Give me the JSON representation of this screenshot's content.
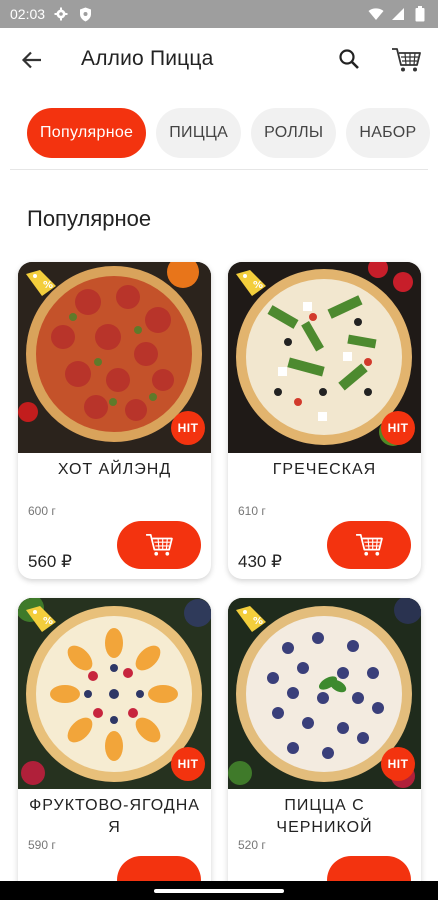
{
  "status_bar": {
    "time": "02:03",
    "icons": [
      "gear-icon",
      "shield-icon",
      "wifi-icon",
      "signal-icon",
      "battery-icon"
    ]
  },
  "app_bar": {
    "title": "Аллио Пицца",
    "back_icon": "arrow-left-icon",
    "search_icon": "search-icon",
    "cart_icon": "cart-icon"
  },
  "tabs": [
    {
      "label": "Популярное",
      "active": true
    },
    {
      "label": "ПИЦЦА",
      "active": false
    },
    {
      "label": "РОЛЛЫ",
      "active": false
    },
    {
      "label": "НАБОР",
      "active": false
    }
  ],
  "section": {
    "title": "Популярное"
  },
  "products": [
    {
      "name": "ХОТ АЙЛЭНД",
      "weight": "600 г",
      "price": "560 ₽",
      "badge": "HIT"
    },
    {
      "name": "ГРЕЧЕСКАЯ",
      "weight": "610 г",
      "price": "430 ₽",
      "badge": "HIT"
    },
    {
      "name": "ФРУКТОВО-ЯГОДНАЯ",
      "name_line1": "ФРУКТОВО-ЯГОДНА",
      "name_line2": "Я",
      "weight": "590 г",
      "price": "",
      "badge": "HIT"
    },
    {
      "name": "ПИЦЦА С ЧЕРНИКОЙ",
      "name_line1": "ПИЦЦА С",
      "name_line2": "ЧЕРНИКОЙ",
      "weight": "520 г",
      "price": "",
      "badge": "HIT"
    }
  ],
  "colors": {
    "accent": "#f3330f",
    "status_bar": "#9e9e9e",
    "tab_inactive": "#f1f1f1"
  }
}
